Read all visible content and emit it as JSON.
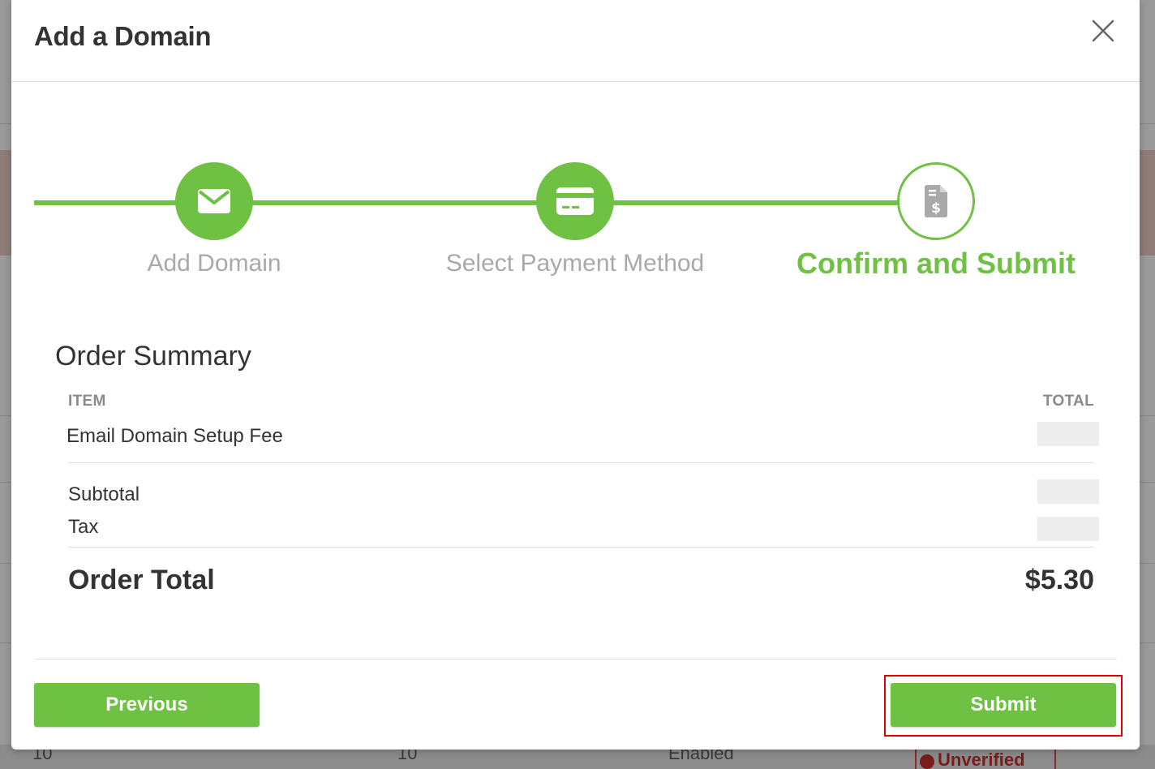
{
  "modal": {
    "title": "Add a Domain"
  },
  "stepper": {
    "steps": [
      {
        "label": "Add Domain",
        "icon": "envelope-icon",
        "state": "completed"
      },
      {
        "label": "Select Payment Method",
        "icon": "credit-card-icon",
        "state": "completed"
      },
      {
        "label": "Confirm and Submit",
        "icon": "invoice-dollar-icon",
        "state": "active"
      }
    ]
  },
  "summary": {
    "title": "Order Summary",
    "col_item": "ITEM",
    "col_total": "TOTAL",
    "item_label": "Email Domain Setup Fee",
    "subtotal_label": "Subtotal",
    "tax_label": "Tax",
    "order_total_label": "Order Total",
    "order_total_value": "$5.30"
  },
  "buttons": {
    "previous": "Previous",
    "submit": "Submit"
  },
  "background": {
    "cell_1": "10",
    "cell_2": "10",
    "cell_3": "Enabled",
    "badge": "Unverified"
  },
  "colors": {
    "accent": "#6fc144",
    "highlight": "#e00000"
  }
}
